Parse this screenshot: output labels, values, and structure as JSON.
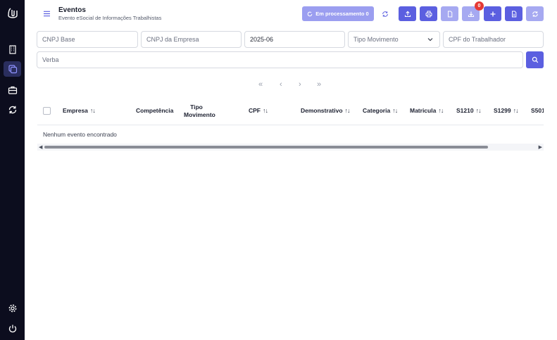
{
  "header": {
    "title": "Eventos",
    "subtitle": "Evento eSocial de Informações Trabalhistas",
    "processing_label": "Em processamento 0",
    "badge_count": "0"
  },
  "sidebar": {
    "items": [
      {
        "icon": "logo-icon"
      },
      {
        "icon": "building-icon"
      },
      {
        "icon": "copy-icon",
        "active": true
      },
      {
        "icon": "briefcase-icon"
      },
      {
        "icon": "sync-icon"
      },
      {
        "icon": "gear-icon"
      },
      {
        "icon": "power-icon"
      }
    ]
  },
  "toolbar": {
    "buttons": [
      "upload-icon",
      "print-icon",
      "file-icon",
      "download-icon",
      "plus-icon",
      "document-icon",
      "refresh-icon"
    ]
  },
  "filters": {
    "cnpj_base_placeholder": "CNPJ Base",
    "cnpj_empresa_placeholder": "CNPJ da Empresa",
    "competencia_value": "2025-06",
    "tipo_movimento_placeholder": "Tipo Movimento",
    "cpf_trabalhador_placeholder": "CPF do Trabalhador",
    "verba_placeholder": "Verba"
  },
  "pagination": {
    "first": "«",
    "prev": "‹",
    "next": "›",
    "last": "»"
  },
  "table": {
    "columns": [
      {
        "label": "Empresa",
        "sortable": true
      },
      {
        "label": "Competência",
        "sortable": false
      },
      {
        "label": "Tipo Movimento",
        "sortable": false
      },
      {
        "label": "CPF",
        "sortable": true
      },
      {
        "label": "Demonstrativo",
        "sortable": true
      },
      {
        "label": "Categoria",
        "sortable": true
      },
      {
        "label": "Matricula",
        "sortable": true
      },
      {
        "label": "S1210",
        "sortable": true
      },
      {
        "label": "S1299",
        "sortable": true
      },
      {
        "label": "S501",
        "sortable": false
      }
    ],
    "sort_symbol": "↑↓",
    "empty_message": "Nenhum evento encontrado"
  },
  "colors": {
    "sidebar_bg": "#0c0d1e",
    "primary": "#5b5fe0",
    "primary_light": "#a6a9f1",
    "badge": "#e53935"
  }
}
